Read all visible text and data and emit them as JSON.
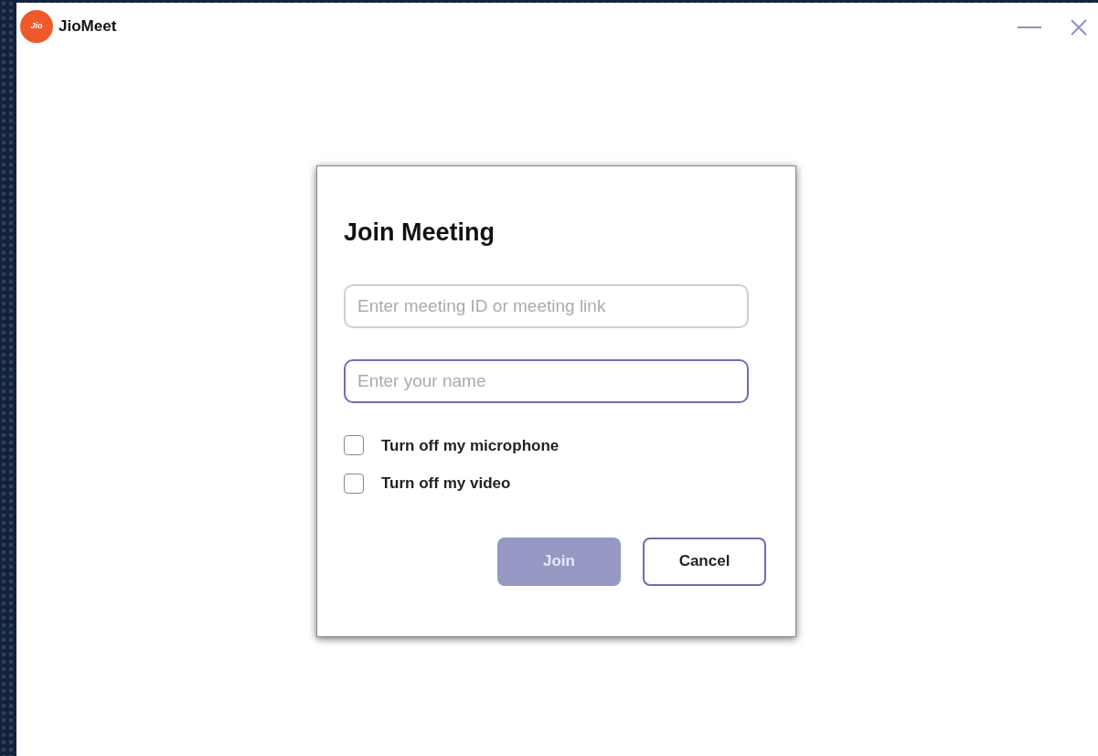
{
  "window": {
    "app_name": "JioMeet",
    "logo_text": "Jio"
  },
  "dialog": {
    "title": "Join Meeting",
    "fields": [
      {
        "placeholder": "Enter meeting ID or meeting link",
        "focused": false
      },
      {
        "placeholder": "Enter your name",
        "focused": true
      }
    ],
    "options": [
      {
        "label": "Turn off my microphone",
        "checked": false
      },
      {
        "label": "Turn off my video",
        "checked": false
      }
    ],
    "buttons": [
      {
        "label": "Join",
        "kind": "primary",
        "disabled": true
      },
      {
        "label": "Cancel",
        "kind": "secondary",
        "disabled": false
      }
    ]
  }
}
